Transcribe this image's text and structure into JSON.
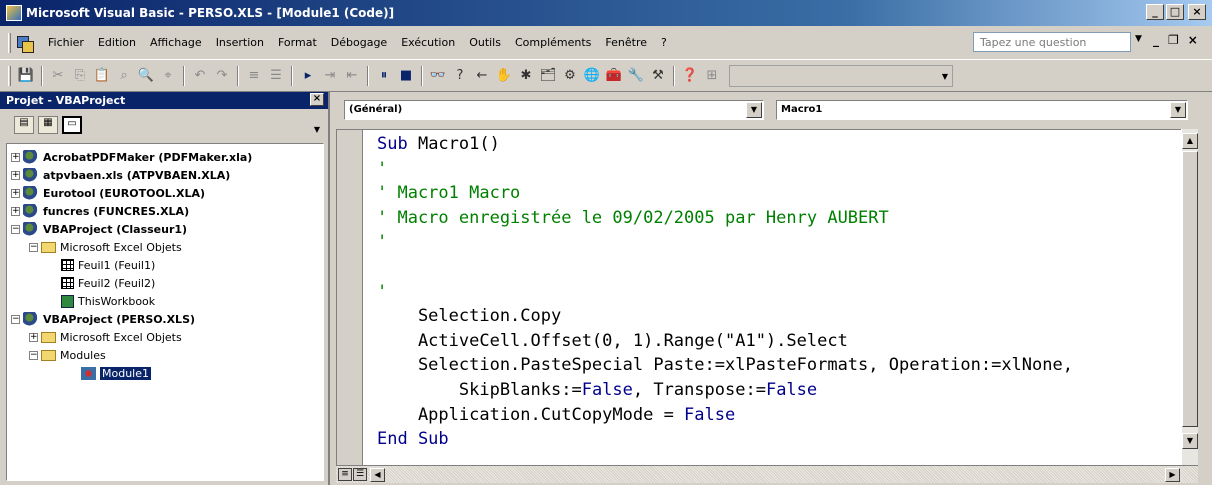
{
  "window": {
    "title": "Microsoft Visual Basic - PERSO.XLS - [Module1 (Code)]"
  },
  "menu": {
    "items": [
      "Fichier",
      "Edition",
      "Affichage",
      "Insertion",
      "Format",
      "Débogage",
      "Exécution",
      "Outils",
      "Compléments",
      "Fenêtre",
      "?"
    ],
    "ask_placeholder": "Tapez une question"
  },
  "project": {
    "title": "Projet - VBAProject",
    "tree": [
      {
        "label": "AcrobatPDFMaker (PDFMaker.xla)",
        "expander": "+"
      },
      {
        "label": "atpvbaen.xls (ATPVBAEN.XLA)",
        "expander": "+"
      },
      {
        "label": "Eurotool (EUROTOOL.XLA)",
        "expander": "+"
      },
      {
        "label": "funcres (FUNCRES.XLA)",
        "expander": "+"
      },
      {
        "label": "VBAProject (Classeur1)",
        "expander": "−"
      },
      {
        "label": "Microsoft Excel Objets",
        "expander": "−"
      },
      {
        "label": "Feuil1 (Feuil1)"
      },
      {
        "label": "Feuil2 (Feuil2)"
      },
      {
        "label": "ThisWorkbook"
      },
      {
        "label": "VBAProject (PERSO.XLS)",
        "expander": "−"
      },
      {
        "label": "Microsoft Excel Objets",
        "expander": "+"
      },
      {
        "label": "Modules",
        "expander": "−"
      },
      {
        "label": "Module1"
      }
    ]
  },
  "code": {
    "object_combo": "(Général)",
    "proc_combo": "Macro1",
    "lines": [
      [
        {
          "t": "Sub ",
          "c": "kw"
        },
        {
          "t": "Macro1()",
          "c": ""
        }
      ],
      [
        {
          "t": "'",
          "c": "cm"
        }
      ],
      [
        {
          "t": "' Macro1 Macro",
          "c": "cm"
        }
      ],
      [
        {
          "t": "' Macro enregistrée le 09/02/2005 par Henry AUBERT",
          "c": "cm"
        }
      ],
      [
        {
          "t": "'",
          "c": "cm"
        }
      ],
      [
        {
          "t": "",
          "c": ""
        }
      ],
      [
        {
          "t": "'",
          "c": "cm"
        }
      ],
      [
        {
          "t": "    Selection.Copy",
          "c": ""
        }
      ],
      [
        {
          "t": "    ActiveCell.Offset(0, 1).Range(\"A1\").Select",
          "c": ""
        }
      ],
      [
        {
          "t": "    Selection.PasteSpecial Paste:=xlPasteFormats, Operation:=xlNone,",
          "c": ""
        }
      ],
      [
        {
          "t": "        SkipBlanks:=",
          "c": ""
        },
        {
          "t": "False",
          "c": "kw"
        },
        {
          "t": ", Transpose:=",
          "c": ""
        },
        {
          "t": "False",
          "c": "kw"
        }
      ],
      [
        {
          "t": "    Application.CutCopyMode = ",
          "c": ""
        },
        {
          "t": "False",
          "c": "kw"
        }
      ],
      [
        {
          "t": "End Sub",
          "c": "kw"
        }
      ]
    ]
  }
}
